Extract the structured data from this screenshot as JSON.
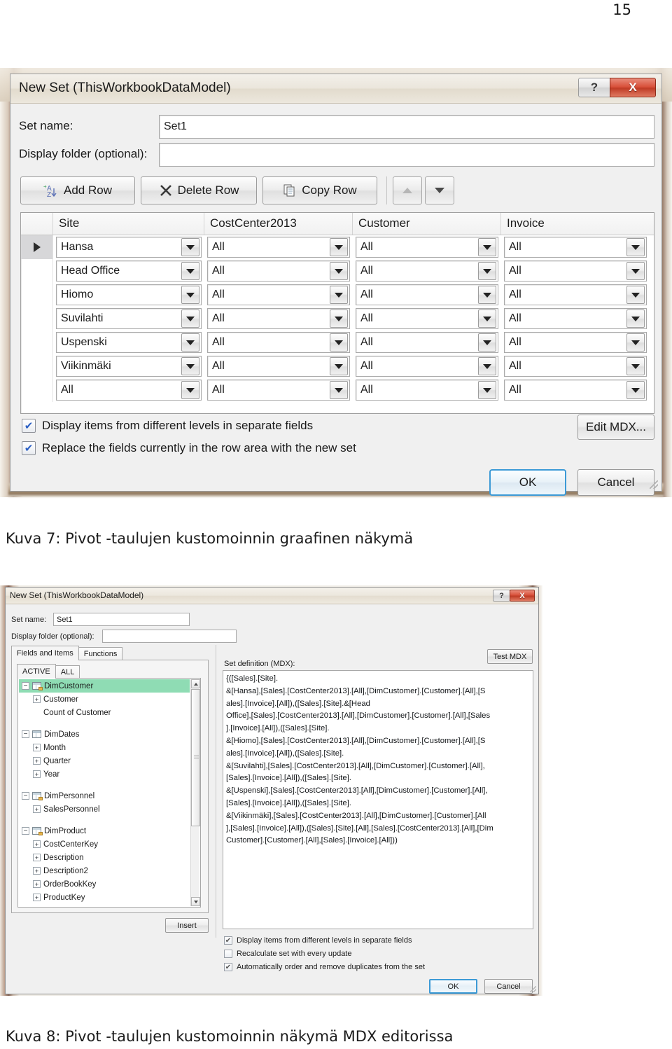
{
  "document": {
    "page_number": "15"
  },
  "figure7": {
    "caption": "Kuva 7: Pivot -taulujen kustomoinnin graafinen näkymä",
    "window": {
      "title": "New Set (ThisWorkbookDataModel)",
      "help_button": "?",
      "close_button": "X"
    },
    "fields": {
      "set_name_label": "Set name:",
      "set_name_value": "Set1",
      "display_folder_label": "Display folder (optional):",
      "display_folder_value": "",
      "display_folder_placeholder": ""
    },
    "toolbar": {
      "add_row": "Add Row",
      "delete_row": "Delete Row",
      "copy_row": "Copy Row",
      "move_up_icon": "triangle-up-icon",
      "move_down_icon": "triangle-down-icon"
    },
    "grid": {
      "columns": [
        "Site",
        "CostCenter2013",
        "Customer",
        "Invoice"
      ],
      "rows": [
        {
          "selected": true,
          "cells": [
            "Hansa",
            "All",
            "All",
            "All"
          ]
        },
        {
          "selected": false,
          "cells": [
            "Head Office",
            "All",
            "All",
            "All"
          ]
        },
        {
          "selected": false,
          "cells": [
            "Hiomo",
            "All",
            "All",
            "All"
          ]
        },
        {
          "selected": false,
          "cells": [
            "Suvilahti",
            "All",
            "All",
            "All"
          ]
        },
        {
          "selected": false,
          "cells": [
            "Uspenski",
            "All",
            "All",
            "All"
          ]
        },
        {
          "selected": false,
          "cells": [
            "Viikinmäki",
            "All",
            "All",
            "All"
          ]
        },
        {
          "selected": false,
          "cells": [
            "All",
            "All",
            "All",
            "All"
          ]
        }
      ]
    },
    "options": [
      {
        "label": "Display items from different levels in separate fields",
        "checked": true
      },
      {
        "label": "Replace the fields currently in the row area with the new set",
        "checked": true
      }
    ],
    "buttons": {
      "edit_mdx": "Edit MDX...",
      "ok": "OK",
      "cancel": "Cancel"
    }
  },
  "figure8": {
    "caption": "Kuva 8: Pivot -taulujen kustomoinnin näkymä MDX editorissa",
    "window": {
      "title": "New Set (ThisWorkbookDataModel)",
      "help_button": "?",
      "close_button": "X"
    },
    "fields": {
      "set_name_label": "Set name:",
      "set_name_value": "Set1",
      "display_folder_label": "Display folder (optional):",
      "display_folder_value": ""
    },
    "tabs": [
      {
        "label": "Fields and Items",
        "active": true
      },
      {
        "label": "Functions",
        "active": false
      }
    ],
    "filter_tabs": [
      {
        "label": "ACTIVE",
        "active": true
      },
      {
        "label": "ALL",
        "active": false
      }
    ],
    "tree": [
      {
        "label": "DimCustomer",
        "level": 0,
        "icon": "table-icon",
        "expander": "minus",
        "selected": true
      },
      {
        "label": "Customer",
        "level": 1,
        "icon": "field-icon",
        "expander": "plus",
        "selected": false
      },
      {
        "label": "Count of Customer",
        "level": 1,
        "icon": "none",
        "expander": "none",
        "selected": false
      },
      {
        "label": "DimDates",
        "level": 0,
        "icon": "table-icon",
        "expander": "minus",
        "selected": false
      },
      {
        "label": "Month",
        "level": 1,
        "icon": "field-icon",
        "expander": "plus",
        "selected": false
      },
      {
        "label": "Quarter",
        "level": 1,
        "icon": "field-icon",
        "expander": "plus",
        "selected": false
      },
      {
        "label": "Year",
        "level": 1,
        "icon": "field-icon",
        "expander": "plus",
        "selected": false
      },
      {
        "label": "DimPersonnel",
        "level": 0,
        "icon": "table-icon",
        "expander": "minus",
        "selected": false
      },
      {
        "label": "SalesPersonnel",
        "level": 1,
        "icon": "field-icon",
        "expander": "plus",
        "selected": false
      },
      {
        "label": "DimProduct",
        "level": 0,
        "icon": "table-icon",
        "expander": "minus",
        "selected": false
      },
      {
        "label": "CostCenterKey",
        "level": 1,
        "icon": "field-icon",
        "expander": "plus",
        "selected": false
      },
      {
        "label": "Description",
        "level": 1,
        "icon": "field-icon",
        "expander": "plus",
        "selected": false
      },
      {
        "label": "Description2",
        "level": 1,
        "icon": "field-icon",
        "expander": "plus",
        "selected": false
      },
      {
        "label": "OrderBookKey",
        "level": 1,
        "icon": "field-icon",
        "expander": "plus",
        "selected": false
      },
      {
        "label": "ProductKey",
        "level": 1,
        "icon": "field-icon",
        "expander": "plus",
        "selected": false
      }
    ],
    "mdx": {
      "label": "Set definition (MDX):",
      "test_button": "Test MDX",
      "lines": [
        "{([Sales].[Site].",
        "&[Hansa],[Sales].[CostCenter2013].[All],[DimCustomer].[Customer].[All],[S",
        "ales].[Invoice].[All]),([Sales].[Site].&[Head",
        "Office],[Sales].[CostCenter2013].[All],[DimCustomer].[Customer].[All],[Sales",
        "].[Invoice].[All]),([Sales].[Site].",
        "&[Hiomo],[Sales].[CostCenter2013].[All],[DimCustomer].[Customer].[All],[S",
        "ales].[Invoice].[All]),([Sales].[Site].",
        "&[Suvilahti],[Sales].[CostCenter2013].[All],[DimCustomer].[Customer].[All],",
        "[Sales].[Invoice].[All]),([Sales].[Site].",
        "&[Uspenski],[Sales].[CostCenter2013].[All],[DimCustomer].[Customer].[All],",
        "[Sales].[Invoice].[All]),([Sales].[Site].",
        "&[Viikinmäki],[Sales].[CostCenter2013].[All],[DimCustomer].[Customer].[All",
        "],[Sales].[Invoice].[All]),([Sales].[Site].[All],[Sales].[CostCenter2013].[All],[Dim",
        "Customer].[Customer].[All],[Sales].[Invoice].[All]))"
      ]
    },
    "options": [
      {
        "label": "Display items from different levels in separate fields",
        "checked": true
      },
      {
        "label": "Recalculate set with every update",
        "checked": false
      },
      {
        "label": "Automatically order and remove duplicates from the set",
        "checked": true
      }
    ],
    "buttons": {
      "insert": "Insert",
      "ok": "OK",
      "cancel": "Cancel"
    }
  },
  "colors": {
    "tree_selection": "#8fdcb4",
    "close_button": "#c03c26",
    "default_button_border": "#3c9ad6",
    "checkbox_check": "#2b5fc4"
  }
}
